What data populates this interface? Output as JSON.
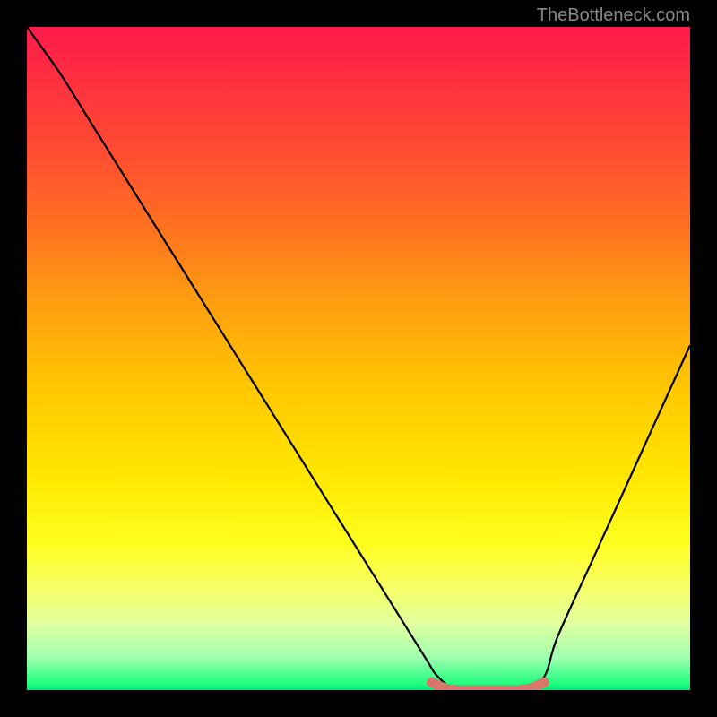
{
  "attribution": "TheBottleneck.com",
  "chart_data": {
    "type": "line",
    "title": "",
    "xlabel": "",
    "ylabel": "",
    "xlim": [
      0,
      100
    ],
    "ylim": [
      0,
      100
    ],
    "series": [
      {
        "name": "bottleneck-curve",
        "x": [
          0,
          5,
          10,
          15,
          20,
          25,
          30,
          35,
          40,
          45,
          50,
          55,
          60,
          62,
          65,
          70,
          75,
          78,
          80,
          85,
          90,
          95,
          100
        ],
        "values": [
          100,
          93,
          85,
          77,
          69,
          61,
          53,
          45,
          37,
          29,
          21,
          13,
          5,
          2,
          0,
          0,
          0,
          2,
          8,
          19,
          30,
          41,
          52
        ]
      },
      {
        "name": "optimal-zone-marker",
        "x": [
          61,
          63,
          65,
          68,
          71,
          74,
          76,
          78
        ],
        "values": [
          1.2,
          0.3,
          0,
          0,
          0,
          0,
          0.3,
          1.2
        ]
      }
    ],
    "colors": {
      "curve": "#000000",
      "marker": "#d9776b",
      "gradient_top": "#ff1a4a",
      "gradient_bottom": "#00e878"
    }
  }
}
